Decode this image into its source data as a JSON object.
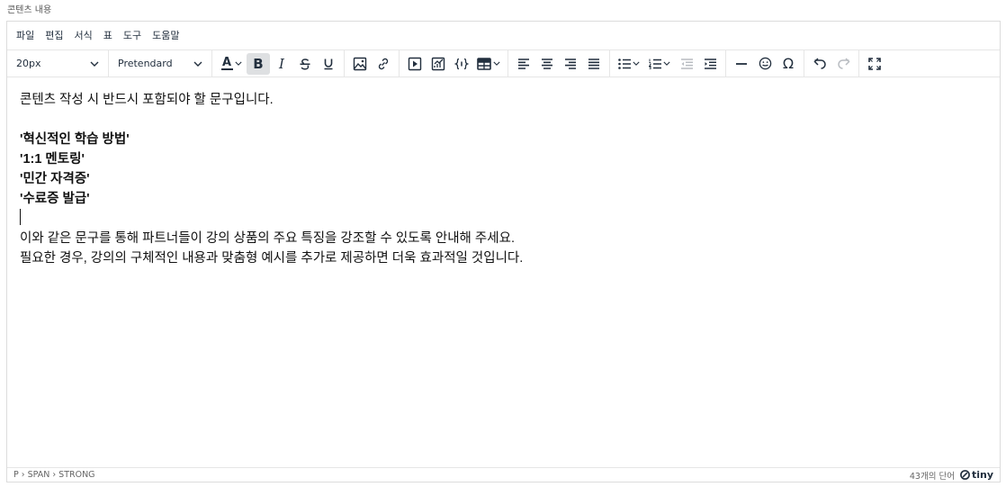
{
  "field_label": "콘텐츠 내용",
  "menubar": {
    "items": [
      "파일",
      "편집",
      "서식",
      "표",
      "도구",
      "도움말"
    ]
  },
  "toolbar": {
    "font_size": "20px",
    "font_family": "Pretendard",
    "text_color_glyph": "A",
    "bold_glyph": "B",
    "italic_glyph": "I",
    "omega_glyph": "Ω",
    "bold_active": true,
    "redo_disabled": true
  },
  "content": {
    "intro": "콘텐츠 작성 시 반드시 포함되야 할 문구입니다.",
    "phrases": [
      "'혁신적인 학습 방법'",
      "'1:1 멘토링'",
      "'민간 자격증'",
      "'수료증 발급'"
    ],
    "line1": "이와 같은 문구를 통해 파트너들이 강의 상품의 주요 특징을 강조할 수 있도록 안내해 주세요.",
    "line2": "필요한 경우, 강의의 구체적인 내용과 맞춤형 예시를 추가로 제공하면 더욱 효과적일 것입니다."
  },
  "statusbar": {
    "path": "P › SPAN › STRONG",
    "word_count": "43개의 단어",
    "brand": "tiny"
  },
  "colors": {
    "text_color_underline": "#222f3e",
    "active_bg": "#dee0e2"
  }
}
